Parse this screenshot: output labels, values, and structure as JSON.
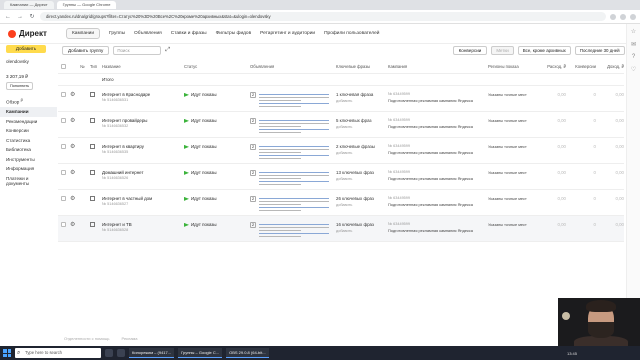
{
  "browser": {
    "tabs": [
      "Кампании — Директ",
      "Группы — Google Chrome"
    ],
    "url": "direct.yandex.ru/dna/grid/groups?filter=Статус%20%3D%20Все%2C%20кроме%20архивных&stat=&ulogin=olendovsky"
  },
  "header": {
    "logo": "Директ",
    "tabs": [
      "Кампании",
      "Группы",
      "Объявления",
      "Ставки и фразы",
      "Фильтры фидов",
      "Ретаргетинг и аудитории",
      "Профили пользователей"
    ],
    "active_tab": "Кампании"
  },
  "sidebar": {
    "add_label": "Добавить",
    "login": "olendovsky",
    "balance": "3 207,19 ₽",
    "topup": "Пополнить",
    "items": [
      {
        "label": "Обзор",
        "badge": "β"
      },
      {
        "label": "Кампании"
      },
      {
        "label": "Рекомендации"
      },
      {
        "label": "Конверсии"
      },
      {
        "label": "Статистика"
      },
      {
        "label": "Библиотека"
      },
      {
        "label": "Инструменты"
      },
      {
        "label": "Информация"
      },
      {
        "label": "Платежи и документы"
      }
    ]
  },
  "toolbar": {
    "add_group": "Добавить группу",
    "search_placeholder": "Поиск",
    "conversions": "Конверсии",
    "tags": "Метки",
    "status_filter": "Все, кроме архивных",
    "period": "Последние 30 дней"
  },
  "table": {
    "headers": [
      "№",
      "Тип",
      "Название",
      "Статус",
      "Объявления",
      "Ключевые фразы",
      "Кампания",
      "Регионы показа",
      "Расход, ₽",
      "Конверсии",
      "Доход, ₽"
    ],
    "totals_label": "Итого",
    "rows": [
      {
        "name": "Интернет в Краснодаре",
        "id": "№ 5146636531",
        "status": "Идут показы",
        "ads": "2",
        "kw": "1 ключевая фраза",
        "kw_add": "добавить",
        "camp_id": "№ 63449599",
        "camp_name": "Подготовленная рекламная кампания Яндекса",
        "region": "Указаны точные мест",
        "expense": "0,00",
        "conv": "0",
        "income": "0,00"
      },
      {
        "name": "Интернет провайдеры",
        "id": "№ 5146636532",
        "status": "Идут показы",
        "ads": "2",
        "kw": "5 ключевых фраз",
        "kw_add": "добавить",
        "camp_id": "№ 63449599",
        "camp_name": "Подготовленная рекламная кампания Яндекса",
        "region": "Указаны точные мест",
        "expense": "0,00",
        "conv": "0",
        "income": "0,00"
      },
      {
        "name": "Интернет в квартиру",
        "id": "№ 5146636535",
        "status": "Идут показы",
        "ads": "2",
        "kw": "2 ключевые фразы",
        "kw_add": "добавить",
        "camp_id": "№ 63449599",
        "camp_name": "Подготовленная рекламная кампания Яндекса",
        "region": "Указаны точные мест",
        "expense": "0,00",
        "conv": "0",
        "income": "0,00"
      },
      {
        "name": "Домашний интернет",
        "id": "№ 5146636526",
        "status": "Идут показы",
        "ads": "2",
        "kw": "13 ключевых фраз",
        "kw_add": "добавить",
        "camp_id": "№ 63449599",
        "camp_name": "Подготовленная рекламная кампания Яндекса",
        "region": "Указаны точные мест",
        "expense": "0,00",
        "conv": "0",
        "income": "0,00"
      },
      {
        "name": "Интернет в частный дом",
        "id": "№ 5146636527",
        "status": "Идут показы",
        "ads": "2",
        "kw": "26 ключевых фраз",
        "kw_add": "добавить",
        "camp_id": "№ 63449599",
        "camp_name": "Подготовленная рекламная кампания Яндекса",
        "region": "Указаны точные мест",
        "expense": "0,00",
        "conv": "0",
        "income": "0,00"
      },
      {
        "name": "Интернет и ТВ",
        "id": "№ 5146636528",
        "status": "Идут показы",
        "ads": "2",
        "kw": "16 ключевых фраз",
        "kw_add": "добавить",
        "camp_id": "№ 63449599",
        "camp_name": "Подготовленная рекламная кампания Яндекса",
        "region": "Указаны точные мест",
        "expense": "0,00",
        "conv": "0",
        "income": "0,00"
      }
    ]
  },
  "footer": {
    "links": [
      "Отделенности с помощь",
      "Реклама"
    ]
  },
  "taskbar": {
    "search": "Type here to search",
    "windows": [
      "Кинорежим – (9417...",
      "Группы – Google C...",
      "OBS 29.0.8 (64-bit..."
    ],
    "time": "13:45"
  },
  "colors": {
    "brand_yellow": "#ffdb4d",
    "status_green": "#3bb33b",
    "logo_red": "#fc3f1d"
  }
}
